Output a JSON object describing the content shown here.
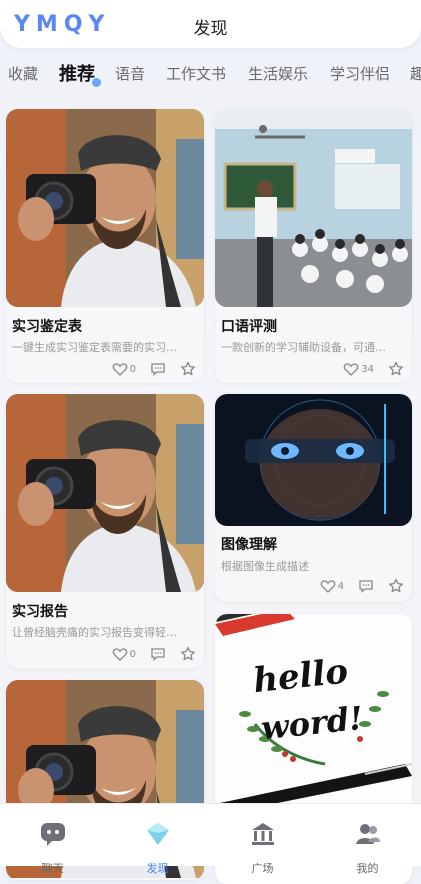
{
  "header": {
    "logo": "YMQY",
    "title": "发现"
  },
  "tabs": [
    {
      "label": "收藏"
    },
    {
      "label": "推荐"
    },
    {
      "label": "语音"
    },
    {
      "label": "工作文书"
    },
    {
      "label": "生活娱乐"
    },
    {
      "label": "学习伴侣"
    },
    {
      "label": "趣"
    }
  ],
  "cards": [
    {
      "title": "实习鉴定表",
      "desc": "一键生成实习鉴定表需要的实习…",
      "likes": "0"
    },
    {
      "title": "口语评测",
      "desc": "一款创新的学习辅助设备，可通…",
      "likes": "34"
    },
    {
      "title": "实习报告",
      "desc": "让曾经脑壳痛的实习报告变得轻…",
      "likes": "0"
    },
    {
      "title": "图像理解",
      "desc": "根据图像生成描述",
      "likes": "4"
    },
    {
      "title": "",
      "desc": "",
      "likes": ""
    },
    {
      "title": "",
      "desc": "",
      "likes": ""
    }
  ],
  "hello_art": {
    "line1": "hello",
    "line2": "word!"
  },
  "bottom_nav": [
    {
      "label": "聊天",
      "icon": "chat-icon"
    },
    {
      "label": "发现",
      "icon": "discover-icon"
    },
    {
      "label": "广场",
      "icon": "museum-icon"
    },
    {
      "label": "我的",
      "icon": "profile-icon"
    }
  ],
  "colors": {
    "accent": "#4a86ff",
    "logo": "#5b86f5"
  }
}
